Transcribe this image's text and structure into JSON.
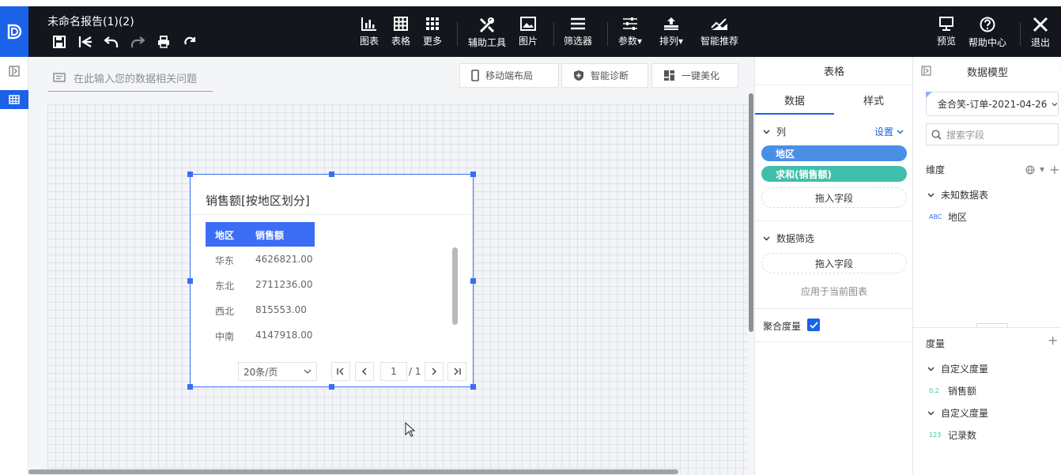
{
  "top": {
    "doc_title": "未命名报告(1)(2)",
    "toolbar": {
      "chart": "图表",
      "table": "表格",
      "more": "更多",
      "aux_tools": "辅助工具",
      "image": "图片",
      "filter": "筛选器",
      "params": "参数▾",
      "arrange": "排列▾",
      "smart_recommend": "智能推荐",
      "preview": "预览",
      "help": "帮助中心",
      "exit": "退出"
    }
  },
  "workspace": {
    "ask_placeholder": "在此输入您的数据相关问题",
    "mobile_layout": "移动端布局",
    "smart_diagnose": "智能诊断",
    "beautify": "一键美化"
  },
  "widget": {
    "title": "销售额[按地区划分]",
    "columns": [
      "地区",
      "销售额"
    ],
    "rows": [
      [
        "华东",
        "4626821.00"
      ],
      [
        "东北",
        "2711236.00"
      ],
      [
        "西北",
        "815553.00"
      ],
      [
        "中南",
        "4147918.00"
      ]
    ],
    "page_size": "20条/页",
    "page": "1",
    "page_total": "/ 1"
  },
  "props": {
    "title": "表格",
    "tab_data": "数据",
    "tab_style": "样式",
    "columns_section": "列",
    "settings": "设置",
    "chip_region": "地区",
    "chip_sum": "求和(销售额)",
    "drop_field": "拖入字段",
    "filter_section": "数据筛选",
    "drop_field_2": "拖入字段",
    "apply_current": "应用于当前图表",
    "aggregate": "聚合度量",
    "colors": {
      "region_chip": "#4a8fe6",
      "sum_chip": "#3fbfaa"
    }
  },
  "model": {
    "title": "数据模型",
    "dataset": "金合笑-订单-2021-04-26",
    "search_placeholder": "搜索字段",
    "dimension": "维度",
    "unknown_table": "未知数据表",
    "field_region": "地区",
    "field_region_badge": "ABC",
    "measure": "度量",
    "custom_measure_1": "自定义度量",
    "field_sales": "销售额",
    "field_sales_badge": "0.2",
    "custom_measure_2": "自定义度量",
    "field_count": "记录数",
    "field_count_badge": "123"
  }
}
